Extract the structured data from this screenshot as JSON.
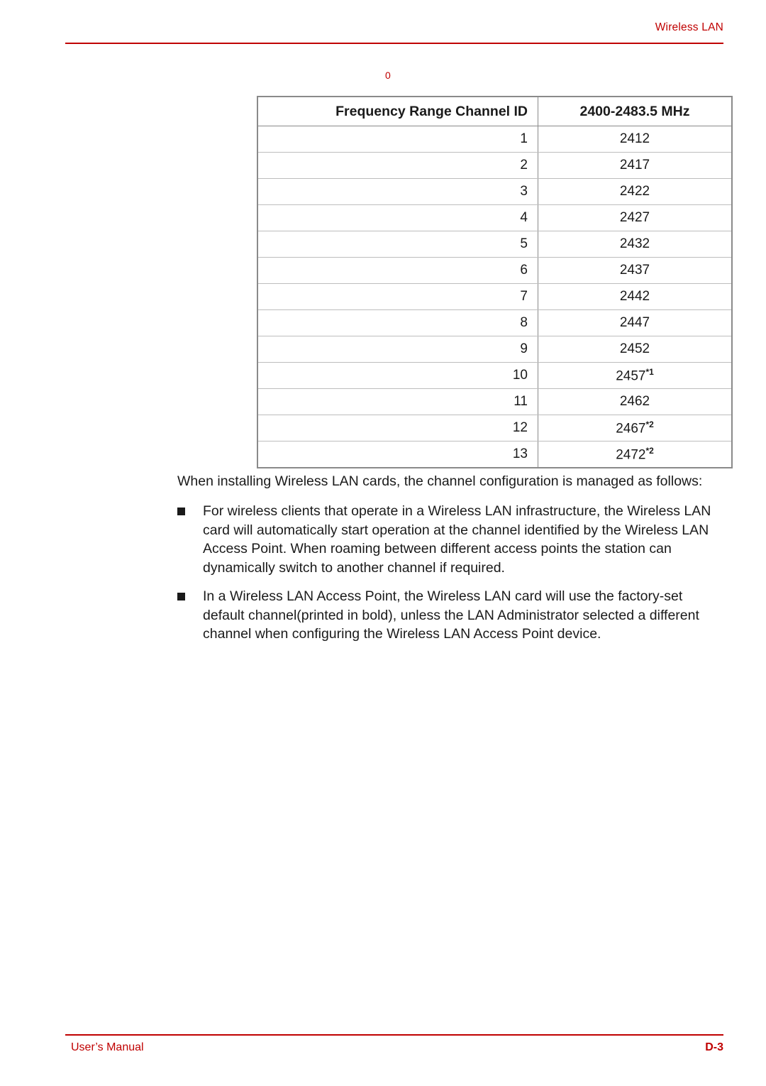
{
  "header": {
    "title": "Wireless LAN"
  },
  "stray_marker": "0",
  "table": {
    "headers": [
      "Frequency Range Channel ID",
      "2400-2483.5 MHz"
    ],
    "rows": [
      {
        "channel": "1",
        "freq": "2412",
        "note": ""
      },
      {
        "channel": "2",
        "freq": "2417",
        "note": ""
      },
      {
        "channel": "3",
        "freq": "2422",
        "note": ""
      },
      {
        "channel": "4",
        "freq": "2427",
        "note": ""
      },
      {
        "channel": "5",
        "freq": "2432",
        "note": ""
      },
      {
        "channel": "6",
        "freq": "2437",
        "note": ""
      },
      {
        "channel": "7",
        "freq": "2442",
        "note": ""
      },
      {
        "channel": "8",
        "freq": "2447",
        "note": ""
      },
      {
        "channel": "9",
        "freq": "2452",
        "note": ""
      },
      {
        "channel": "10",
        "freq": "2457",
        "note": "*1"
      },
      {
        "channel": "11",
        "freq": "2462",
        "note": ""
      },
      {
        "channel": "12",
        "freq": "2467",
        "note": "*2"
      },
      {
        "channel": "13",
        "freq": "2472",
        "note": "*2"
      }
    ]
  },
  "body": {
    "intro": "When installing Wireless LAN cards, the channel configuration is managed as follows:",
    "bullets": [
      "For wireless clients that operate in a Wireless LAN infrastructure, the Wireless LAN card will automatically start operation at the channel identified by the Wireless LAN Access Point. When roaming between different access points the station can dynamically switch to another channel if required.",
      "In a Wireless LAN Access Point, the Wireless LAN card will use the factory-set default channel(printed in bold), unless the LAN Administrator selected a different channel when configuring the Wireless LAN Access Point device."
    ]
  },
  "footer": {
    "left": "User’s Manual",
    "right": "D-3"
  },
  "colors": {
    "accent": "#c00000",
    "text": "#1a1a1a",
    "table_border": "#8a8a8a",
    "table_inner_border": "#bdbdbd"
  }
}
